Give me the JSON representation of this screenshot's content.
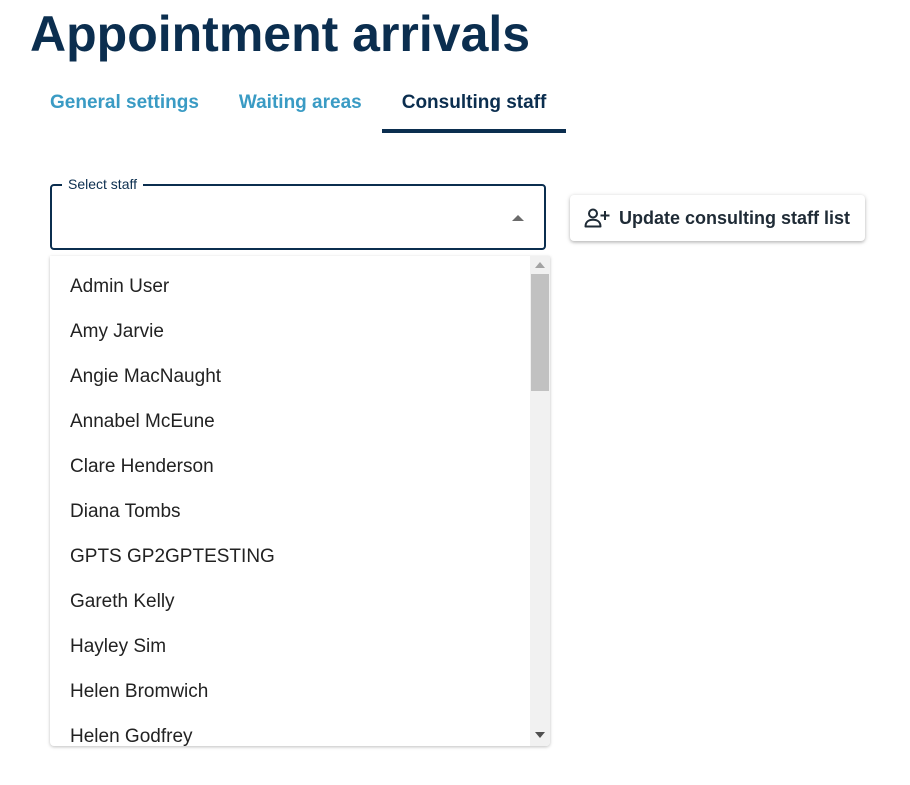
{
  "page": {
    "title": "Appointment arrivals"
  },
  "tabs": [
    {
      "label": "General settings",
      "active": false
    },
    {
      "label": "Waiting areas",
      "active": false
    },
    {
      "label": "Consulting staff",
      "active": true
    }
  ],
  "staff_select": {
    "label": "Select staff",
    "value": "",
    "expanded": true,
    "options": [
      "Admin User",
      "Amy Jarvie",
      "Angie MacNaught",
      "Annabel McEune",
      "Clare Henderson",
      "Diana Tombs",
      "GPTS GP2GPTESTING",
      "Gareth Kelly",
      "Hayley Sim",
      "Helen Bromwich",
      "Helen Godfrey"
    ]
  },
  "update_button": {
    "label": "Update consulting staff list",
    "icon": "person-add-icon"
  },
  "colors": {
    "primary": "#0b2e4f",
    "tab_inactive": "#3a9bc4",
    "text": "#222222"
  }
}
